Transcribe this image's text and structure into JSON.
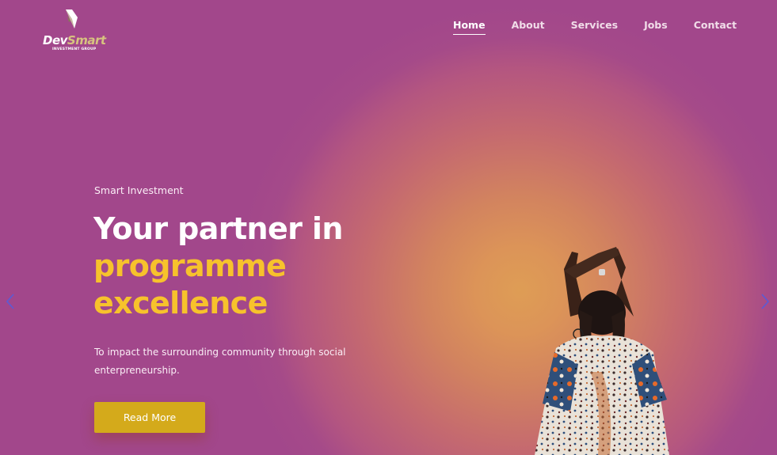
{
  "brand": {
    "name_part1": "Dev",
    "name_part2": "Smart",
    "tagline": "INVESTMENT GROUP",
    "accent_color": "#d7c37f"
  },
  "nav": {
    "items": [
      {
        "label": "Home",
        "active": true
      },
      {
        "label": "About",
        "active": false
      },
      {
        "label": "Services",
        "active": false
      },
      {
        "label": "Jobs",
        "active": false
      },
      {
        "label": "Contact",
        "active": false
      }
    ]
  },
  "hero": {
    "eyebrow": "Smart Investment",
    "headline_line1": "Your partner in",
    "headline_line2": "programme",
    "headline_line3": "excellence",
    "description": "To impact the surrounding community through social enterpreneurship.",
    "cta_label": "Read More",
    "headline_accent_color": "#f7c22c",
    "cta_color": "#d4aa1b"
  },
  "slider": {
    "prev_icon": "chevron-left-icon",
    "next_icon": "chevron-right-icon"
  },
  "colors": {
    "background": "#a2478b",
    "glow": "#de9d55"
  }
}
